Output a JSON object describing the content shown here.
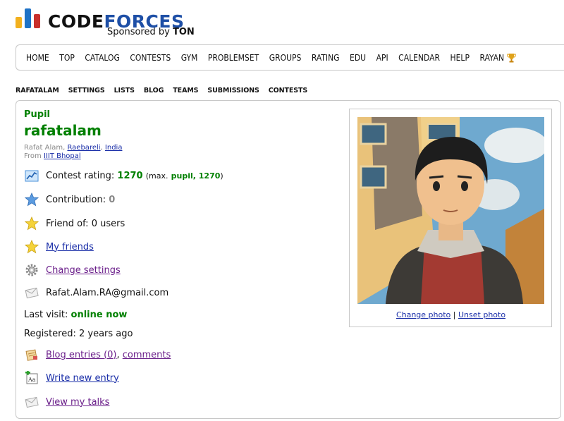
{
  "logo": {
    "part1": "CODE",
    "part2": "FORCES",
    "sponsor_prefix": "Sponsored by",
    "sponsor_name": "TON",
    "colors": [
      "#f2b01e",
      "#1e72c6",
      "#c9302c"
    ]
  },
  "main_nav": [
    "HOME",
    "TOP",
    "CATALOG",
    "CONTESTS",
    "GYM",
    "PROBLEMSET",
    "GROUPS",
    "RATING",
    "EDU",
    "API",
    "CALENDAR",
    "HELP",
    "RAYAN"
  ],
  "sub_nav": [
    "RAFATALAM",
    "SETTINGS",
    "LISTS",
    "BLOG",
    "TEAMS",
    "SUBMISSIONS",
    "CONTESTS"
  ],
  "profile": {
    "rank": "Pupil",
    "handle": "rafatalam",
    "name": "Rafat Alam",
    "city": "Raebareli",
    "country": "India",
    "from_label": "From",
    "organization": "IIIT Bhopal",
    "rating_label": "Contest rating:",
    "rating": "1270",
    "max_prefix": "(max.",
    "max_rank": "pupil, 1270",
    "max_suffix": ")",
    "contribution_label": "Contribution:",
    "contribution": "0",
    "friend_of": "Friend of: 0 users",
    "my_friends": "My friends",
    "change_settings": "Change settings",
    "email": "Rafat.Alam.RA@gmail.com",
    "last_visit_label": "Last visit:",
    "last_visit": "online now",
    "registered": "Registered: 2 years ago",
    "blog_entries": "Blog entries (0)",
    "comments": "comments",
    "write_entry": "Write new entry",
    "view_talks": "View my talks"
  },
  "photo": {
    "change": "Change photo",
    "separator": "|",
    "unset": "Unset photo"
  },
  "colors": {
    "pupil": "#008000",
    "link": "#1a2ea8",
    "visited": "#6a1e8a",
    "border": "#c8c8c8"
  }
}
